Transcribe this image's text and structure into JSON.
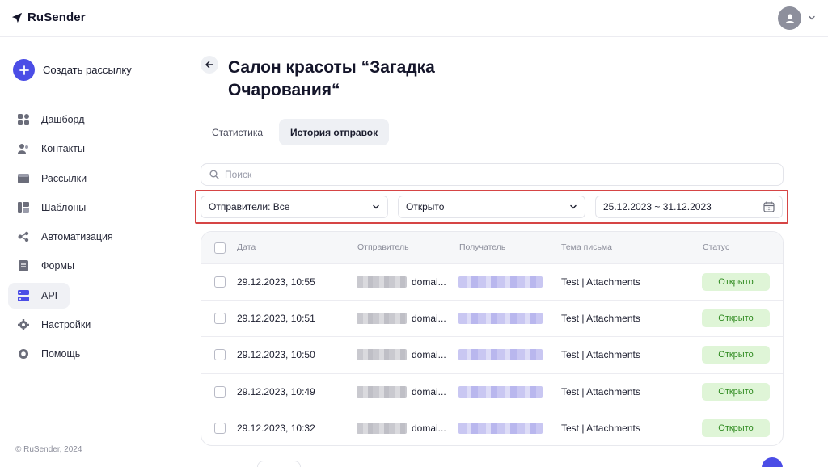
{
  "brand": {
    "name": "RuSender"
  },
  "sidebar": {
    "create_label": "Создать рассылку",
    "items": [
      {
        "label": "Дашборд",
        "icon": "dashboard-icon"
      },
      {
        "label": "Контакты",
        "icon": "contacts-icon"
      },
      {
        "label": "Рассылки",
        "icon": "mailings-icon"
      },
      {
        "label": "Шаблоны",
        "icon": "templates-icon"
      },
      {
        "label": "Автоматизация",
        "icon": "automation-icon"
      },
      {
        "label": "Формы",
        "icon": "forms-icon"
      },
      {
        "label": "API",
        "icon": "api-icon",
        "active": true
      },
      {
        "label": "Настройки",
        "icon": "settings-icon"
      },
      {
        "label": "Помощь",
        "icon": "help-icon"
      }
    ],
    "copyright": "© RuSender, 2024"
  },
  "page": {
    "title": "Салон красоты “Загадка Очарования“"
  },
  "tabs": [
    {
      "label": "Статистика",
      "active": false
    },
    {
      "label": "История отправок",
      "active": true
    }
  ],
  "search": {
    "placeholder": "Поиск",
    "value": ""
  },
  "filters": {
    "sender": "Отправители: Все",
    "status": "Открыто",
    "date_range": "25.12.2023 ~ 31.12.2023"
  },
  "table": {
    "columns": [
      "Дата",
      "Отправитель",
      "Получатель",
      "Тема письма",
      "Статус"
    ],
    "rows": [
      {
        "date": "29.12.2023, 10:55",
        "sender": "domai...",
        "subject": "Test | Attachments",
        "status": "Открыто"
      },
      {
        "date": "29.12.2023, 10:51",
        "sender": "domai...",
        "subject": "Test | Attachments",
        "status": "Открыто"
      },
      {
        "date": "29.12.2023, 10:50",
        "sender": "domai...",
        "subject": "Test | Attachments",
        "status": "Открыто"
      },
      {
        "date": "29.12.2023, 10:49",
        "sender": "domai...",
        "subject": "Test | Attachments",
        "status": "Открыто"
      },
      {
        "date": "29.12.2023, 10:32",
        "sender": "domai...",
        "subject": "Test | Attachments",
        "status": "Открыто"
      }
    ]
  },
  "colors": {
    "accent": "#4b4de6",
    "status_bg": "#dff5d7",
    "status_text": "#2e8a1f",
    "highlight_frame": "#d64545"
  }
}
